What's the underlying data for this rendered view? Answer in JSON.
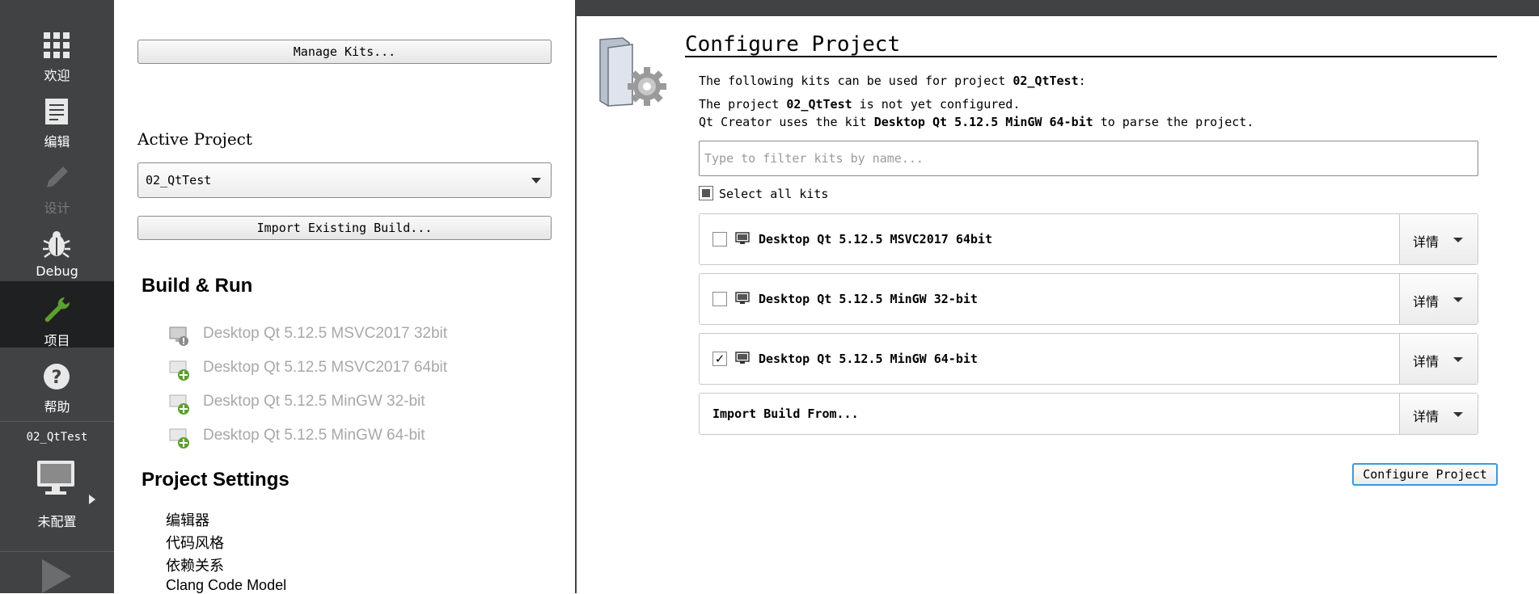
{
  "modes": [
    {
      "label": "欢迎",
      "icon": "welcome-grid-icon"
    },
    {
      "label": "编辑",
      "icon": "edit-document-icon"
    },
    {
      "label": "设计",
      "icon": "design-pencil-icon"
    },
    {
      "label": "Debug",
      "icon": "debug-bug-icon"
    },
    {
      "label": "项目",
      "icon": "projects-wrench-icon"
    },
    {
      "label": "帮助",
      "icon": "help-question-icon"
    }
  ],
  "target_selector": {
    "project": "02_QtTest",
    "status": "未配置",
    "icon": "monitor-icon"
  },
  "left_panel": {
    "manage_kits": "Manage Kits...",
    "active_project_heading": "Active Project",
    "active_project_value": "02_QtTest",
    "import_existing_build": "Import Existing Build...",
    "build_run_heading": "Build & Run",
    "build_run_targets": [
      {
        "name": "Desktop Qt 5.12.5 MSVC2017 32bit",
        "icon": "kit-warning-icon"
      },
      {
        "name": "Desktop Qt 5.12.5 MSVC2017 64bit",
        "icon": "kit-add-icon"
      },
      {
        "name": "Desktop Qt 5.12.5 MinGW 32-bit",
        "icon": "kit-add-icon"
      },
      {
        "name": "Desktop Qt 5.12.5 MinGW 64-bit",
        "icon": "kit-add-icon"
      }
    ],
    "project_settings_heading": "Project Settings",
    "project_settings_items": [
      "编辑器",
      "代码风格",
      "依赖关系",
      "Clang Code Model"
    ]
  },
  "configure": {
    "title": "Configure Project",
    "intro_prefix": "The following kits can be used for project ",
    "intro_project": "02_QtTest",
    "intro_suffix": ":",
    "notconf_prefix": "The project ",
    "notconf_project": "02_QtTest",
    "notconf_suffix": " is not yet configured.",
    "parse_prefix": "Qt Creator uses the kit ",
    "parse_kit": "Desktop Qt 5.12.5 MinGW 64-bit",
    "parse_suffix": " to parse the project.",
    "filter_placeholder": "Type to filter kits by name...",
    "select_all_label": "Select all kits",
    "details_label": "详情",
    "kits": [
      {
        "name": "Desktop Qt 5.12.5 MSVC2017 64bit",
        "checked": false
      },
      {
        "name": "Desktop Qt 5.12.5 MinGW 32-bit",
        "checked": false
      },
      {
        "name": "Desktop Qt 5.12.5 MinGW 64-bit",
        "checked": true
      }
    ],
    "import_build_from": "Import Build From...",
    "configure_button": "Configure Project"
  },
  "colors": {
    "sidebar": "#404244",
    "sidebar_active": "#1f2021",
    "wrench_green": "#5ca02e",
    "focus_blue": "#3c9ad7"
  }
}
